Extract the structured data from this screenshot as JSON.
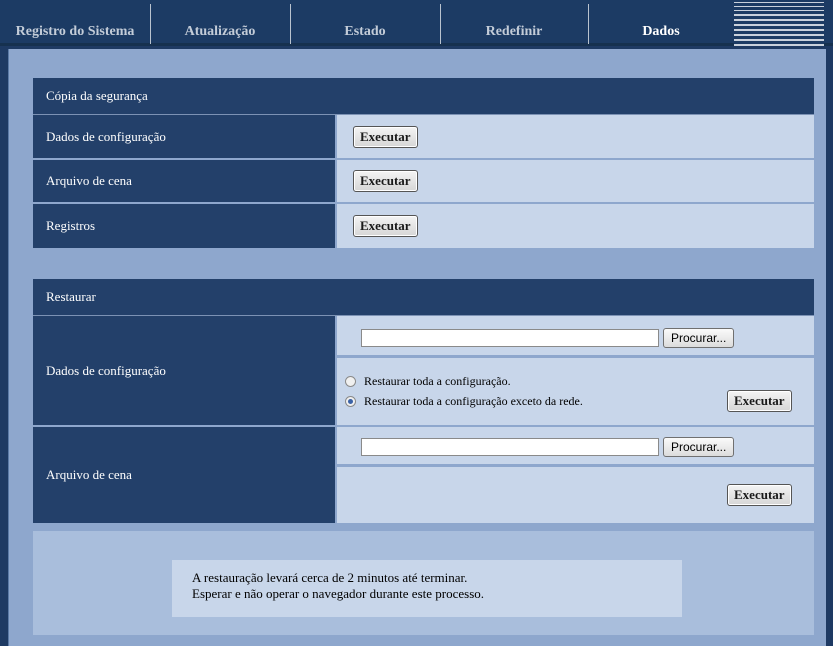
{
  "tabs": [
    {
      "label": "Registro do Sistema",
      "active": false
    },
    {
      "label": "Atualização",
      "active": false
    },
    {
      "label": "Estado",
      "active": false
    },
    {
      "label": "Redefinir",
      "active": false
    },
    {
      "label": "Dados",
      "active": true
    }
  ],
  "backup": {
    "title": "Cópia da segurança",
    "rows": [
      {
        "label": "Dados de configuração",
        "button": "Executar"
      },
      {
        "label": "Arquivo de cena",
        "button": "Executar"
      },
      {
        "label": "Registros",
        "button": "Executar"
      }
    ]
  },
  "restore": {
    "title": "Restaurar",
    "config": {
      "label": "Dados de configuração",
      "file_value": "",
      "browse": "Procurar...",
      "option_all": "Restaurar toda a configuração.",
      "option_except_network": "Restaurar toda a configuração exceto da rede.",
      "selected": "except_network",
      "execute": "Executar"
    },
    "scene": {
      "label": "Arquivo de cena",
      "file_value": "",
      "browse": "Procurar...",
      "execute": "Executar"
    }
  },
  "notice": {
    "line1": "A restauração levará cerca de 2 minutos até terminar.",
    "line2": "Esperar e não operar o navegador durante este processo."
  }
}
